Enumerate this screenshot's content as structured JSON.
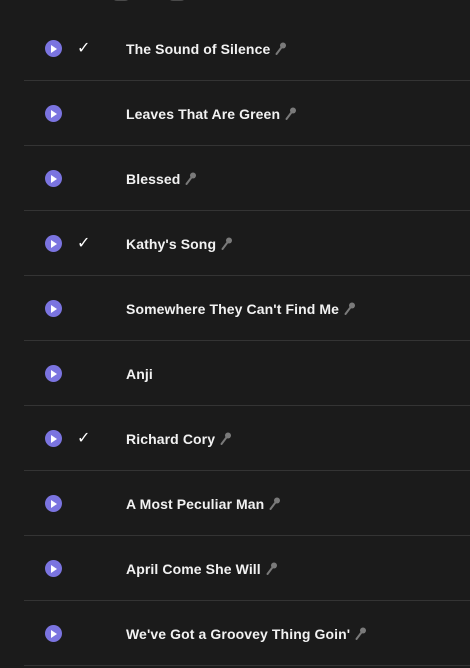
{
  "colors": {
    "accent": "#7b74e0",
    "background": "#1b1b1b",
    "divider": "#343434"
  },
  "tracks": [
    {
      "title": "The Sound of Silence",
      "checked": true,
      "lyrics": true
    },
    {
      "title": "Leaves That Are Green",
      "checked": false,
      "lyrics": true
    },
    {
      "title": "Blessed",
      "checked": false,
      "lyrics": true
    },
    {
      "title": "Kathy's Song",
      "checked": true,
      "lyrics": true
    },
    {
      "title": "Somewhere They Can't Find Me",
      "checked": false,
      "lyrics": true
    },
    {
      "title": "Anji",
      "checked": false,
      "lyrics": false
    },
    {
      "title": "Richard Cory",
      "checked": true,
      "lyrics": true
    },
    {
      "title": "A Most Peculiar Man",
      "checked": false,
      "lyrics": true
    },
    {
      "title": "April Come She Will",
      "checked": false,
      "lyrics": true
    },
    {
      "title": "We've Got a Groovey Thing Goin'",
      "checked": false,
      "lyrics": true
    }
  ],
  "icons": {
    "play": "play-circle-icon",
    "check": "checkmark-icon",
    "lyrics": "microphone-icon"
  }
}
